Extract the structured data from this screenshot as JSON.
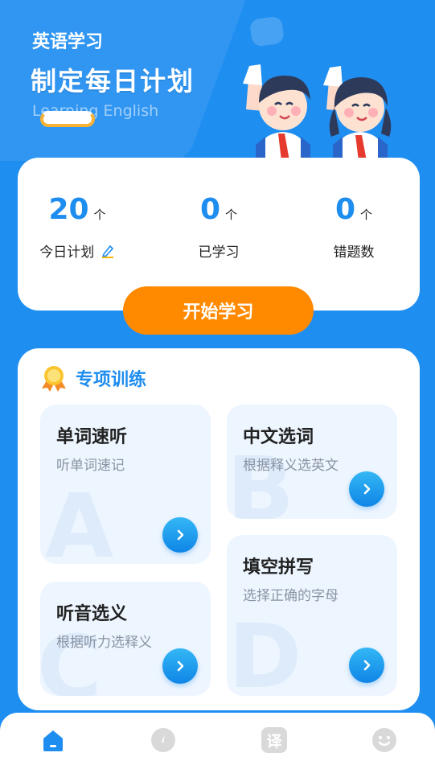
{
  "hero": {
    "subtitle": "英语学习",
    "title": "制定每日计划",
    "english": "Learning English"
  },
  "stats": [
    {
      "value": "20",
      "unit": "个",
      "label": "今日计划"
    },
    {
      "value": "0",
      "unit": "个",
      "label": "已学习"
    },
    {
      "value": "0",
      "unit": "个",
      "label": "错题数"
    }
  ],
  "start_button": "开始学习",
  "training": {
    "title": "专项训练",
    "tiles": [
      {
        "title": "单词速听",
        "subtitle": "听单词速记",
        "letter": "A"
      },
      {
        "title": "中文选词",
        "subtitle": "根据释义选英文",
        "letter": "B"
      },
      {
        "title": "听音选义",
        "subtitle": "根据听力选释义",
        "letter": "C"
      },
      {
        "title": "填空拼写",
        "subtitle": "选择正确的字母",
        "letter": "D"
      }
    ]
  },
  "tabbar": {
    "items": [
      {
        "icon": "home-icon",
        "active": true
      },
      {
        "icon": "compass-icon",
        "active": false
      },
      {
        "icon": "translate-icon",
        "label": "译",
        "active": false
      },
      {
        "icon": "smile-icon",
        "active": false
      }
    ]
  },
  "colors": {
    "primary": "#1F8EF1",
    "accent": "#FF8A00",
    "tile": "#EDF5FF"
  }
}
